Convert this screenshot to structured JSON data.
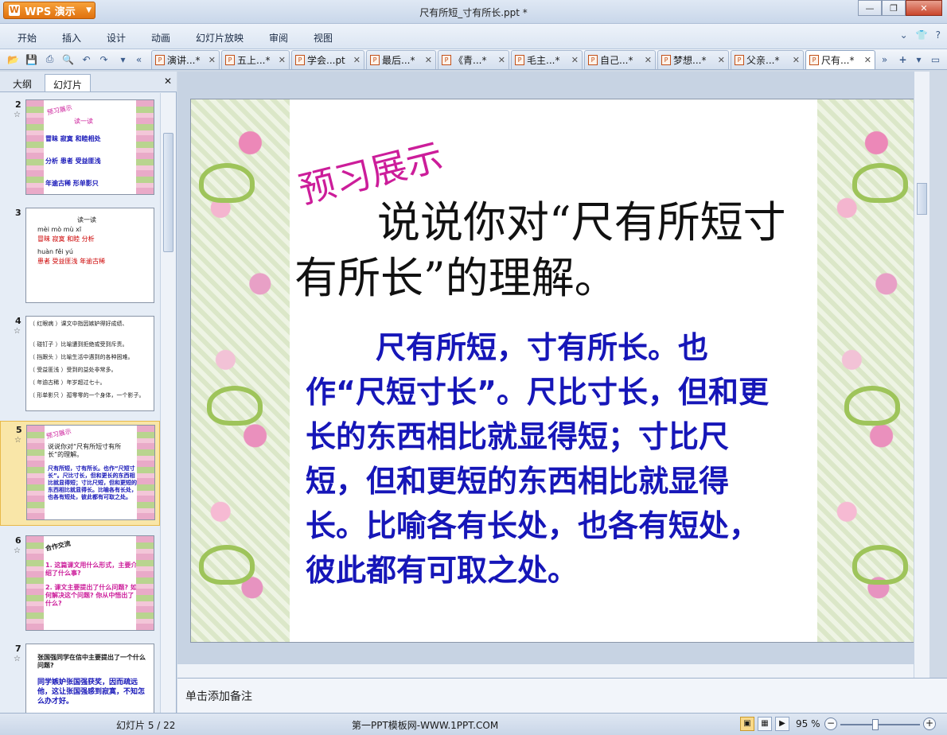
{
  "app": {
    "button_label": "WPS 演示",
    "document_title": "尺有所短_寸有所长.ppt *"
  },
  "window_controls": {
    "minimize": "—",
    "restore": "❐",
    "close": "✕"
  },
  "menu": {
    "items": [
      "开始",
      "插入",
      "设计",
      "动画",
      "幻灯片放映",
      "审阅",
      "视图"
    ],
    "right": {
      "collapse": "⌄",
      "skin": "👕",
      "help": "?"
    }
  },
  "tabs": [
    {
      "label": "演讲...*",
      "active": false
    },
    {
      "label": "五上...*",
      "active": false
    },
    {
      "label": "学会...pt",
      "active": false
    },
    {
      "label": "最后...*",
      "active": false
    },
    {
      "label": "《青...*",
      "active": false
    },
    {
      "label": "毛主...*",
      "active": false
    },
    {
      "label": "自己...*",
      "active": false
    },
    {
      "label": "梦想...*",
      "active": false
    },
    {
      "label": "父亲...*",
      "active": false
    },
    {
      "label": "尺有...*",
      "active": true
    }
  ],
  "left_panel": {
    "tabs": [
      "大纲",
      "幻灯片"
    ],
    "close": "✕",
    "slides": [
      {
        "number": "2",
        "lines": [
          "预习展示",
          "读一读",
          "冒昧 寂寞 和睦相处",
          "分析 患者 受益匪浅",
          "年逾古稀 形单影只"
        ]
      },
      {
        "number": "3",
        "lines": [
          "读一读",
          "mèi mò mù xī",
          "冒昧 寂寞 和睦 分析",
          "huàn fěi yú",
          "患者 受益匪浅 年逾古稀"
        ]
      },
      {
        "number": "4",
        "lines": [
          "（ 红眼病 ）课文中指因嫉妒得好成绩、",
          "（ 碰钉子 ）比喻遭到拒绝或受到斥责。",
          "（ 挡跟头 ）比喻生活中遇到的各种困难。",
          "（ 受益匪浅 ）受到的益处非常多。",
          "（ 年逾古稀 ）年岁超过七十。",
          "（ 形单影只 ）孤零零的一个身体，一个影子。"
        ]
      },
      {
        "number": "5",
        "lines": [
          "预习展示",
          "说说你对“尺有所短寸有所长”的理解。",
          "尺有所短，寸有所长。也作“尺短寸长”。尺比寸长，但和更长的东西相比就显得短；寸比尺短，但和更短的东西相比就显得长。比喻各有长处，也各有短处，彼此都有可取之处。"
        ]
      },
      {
        "number": "6",
        "lines": [
          "合作交流",
          "1. 这篇课文用什么形式，主要介绍了什么事?",
          "2. 课文主要提出了什么问题? 如何解决这个问题? 你从中悟出了什么?"
        ]
      },
      {
        "number": "7",
        "lines": [
          "张国强同学在信中主要提出了一个什么问题?",
          "同学嫉妒张国强获奖，因而疏远他，这让张国强感到寂寞，不知怎么办才好。"
        ]
      }
    ]
  },
  "slide": {
    "tag": "预习展示",
    "question": "说说你对“尺有所短寸有所长”的理解。",
    "answer": "尺有所短，寸有所长。也作“尺短寸长”。尺比寸长，但和更长的东西相比就显得短；寸比尺短，但和更短的东西相比就显得长。比喻各有长处，也各有短处，彼此都有可取之处。"
  },
  "notes_placeholder": "单击添加备注",
  "status": {
    "slide_counter": "幻灯片 5 / 22",
    "template": "第一PPT模板网-WWW.1PPT.COM",
    "zoom": "95 %"
  },
  "colors": {
    "tag": "#cc1d9a",
    "answer_text": "#1616b8",
    "question_text": "#111111",
    "selected_thumb": "#f9e6a8"
  }
}
